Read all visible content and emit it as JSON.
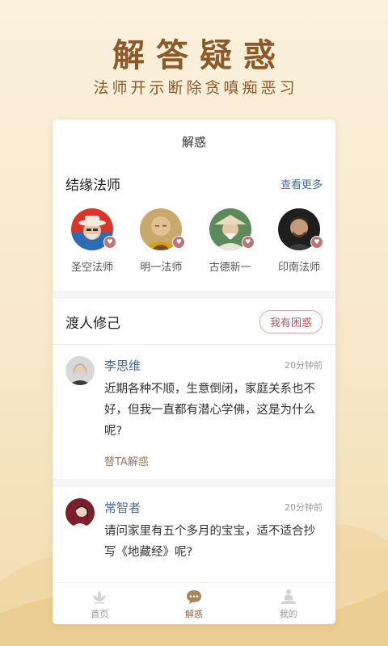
{
  "hero": {
    "title": "解答疑惑",
    "subtitle": "法师开示断除贪嗔痴恶习"
  },
  "card": {
    "header_title": "解惑"
  },
  "masters_section": {
    "title": "结缘法师",
    "more_label": "查看更多",
    "masters": [
      {
        "name": "圣空法师",
        "avatar": "avatar-man-hat"
      },
      {
        "name": "明一法师",
        "avatar": "avatar-monk"
      },
      {
        "name": "古德新一",
        "avatar": "avatar-elder-hat"
      },
      {
        "name": "印南法师",
        "avatar": "avatar-young-man"
      }
    ],
    "badge_icon": "heart-badge-icon",
    "badge_color": "#b9777a"
  },
  "posts_section": {
    "title": "渡人修己",
    "ask_label": "我有困惑",
    "posts": [
      {
        "name": "李思维",
        "time": "20分钟前",
        "text": "近期各种不顺，生意倒闭，家庭关系也不好，但我一直都有潜心学佛，这是为什么呢?",
        "action": "替TA解惑"
      },
      {
        "name": "常智者",
        "time": "20分钟前",
        "text": "请问家里有五个多月的宝宝，适不适合抄写《地藏经》呢?"
      }
    ]
  },
  "tabbar": {
    "tabs": [
      {
        "label": "首页",
        "icon": "lotus-icon"
      },
      {
        "label": "解惑",
        "icon": "chat-bubble-icon"
      },
      {
        "label": "我的",
        "icon": "meditation-person-icon"
      }
    ],
    "active_index": 1
  },
  "colors": {
    "accent_brown": "#8b5a2b",
    "link_blue": "#4a6b9a",
    "ask_red": "#b55660"
  }
}
